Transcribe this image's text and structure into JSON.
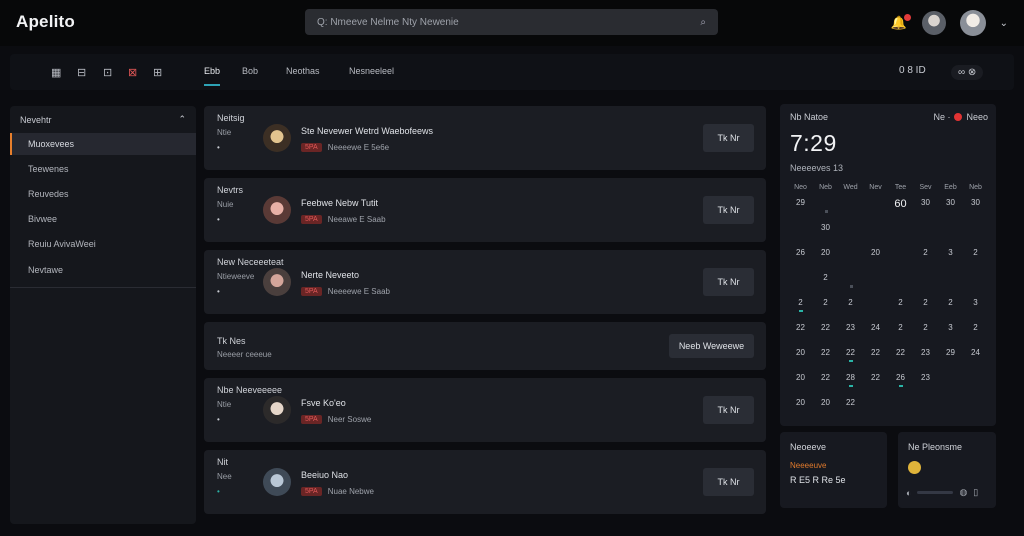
{
  "app": {
    "title": "Apelito"
  },
  "search": {
    "text": "Q: Nmeeve Nelme Nty Newenie",
    "icon": "search-icon"
  },
  "topbar": {
    "bell_icon": "bell-icon",
    "chevron": "⌄"
  },
  "subnav": {
    "icons": [
      "▦",
      "⊟",
      "⊡",
      "⊠",
      "⊞"
    ],
    "tabs": [
      "Ebb",
      "Bob",
      "Neothas",
      "Nesneeleel"
    ],
    "right_a": "0 8 ID",
    "right_b": "∞ ⊗"
  },
  "sidebar": {
    "header": "Nevehtr",
    "items": [
      "Muoxevees",
      "Teewenes",
      "Reuvedes",
      "Bivwee",
      "Reuiu AvivaWeei",
      "Nevtawe"
    ]
  },
  "cards": [
    {
      "label": "Neitsig",
      "sub": "Ntie",
      "bullet": "•",
      "name": "Ste Nevewer Wetrd Waebofeews",
      "badge": "5PA",
      "meta": "Neeeewe E 5e6e",
      "button": "Tk Nr"
    },
    {
      "label": "Nevtrs",
      "sub": "Nuie",
      "bullet": "•",
      "name": "Feebwe Nebw Tutit",
      "badge": "5PA",
      "meta": "Neeawe E Saab",
      "button": "Tk Nr"
    },
    {
      "label": "New Neceeeteat",
      "sub": "Ntieweeve",
      "bullet": "•",
      "name": "Nerte Neveeto",
      "badge": "5PA",
      "meta": "Neeeewe E Saab",
      "button": "Tk Nr"
    },
    {
      "label": "Tk Nes",
      "sub": "Neeeer ceeeue",
      "wide_button": "Neeb Weweewe"
    },
    {
      "label": "Nbe Neeveeeee",
      "sub": "Ntie",
      "bullet": "•",
      "name": "Fsve Ko'eo",
      "badge": "5PA",
      "meta": "Neer   Soswe",
      "button": "Tk Nr"
    },
    {
      "label": "Nit",
      "sub": "Nee",
      "bullet": "•",
      "name": "Beeiuo Nao",
      "badge": "5PA",
      "meta": "Nuae   Nebwe",
      "button": "Tk Nr"
    }
  ],
  "calendar": {
    "title": "Nb Natoe",
    "right_label": "Ne ·",
    "right_label2": "Neeo",
    "time": "7:29",
    "subtitle": "Neeeeves 13",
    "weekdays": [
      "Neo",
      "Neb",
      "Wed",
      "Nev",
      "Tee",
      "Sev",
      "Eeb",
      "Neb"
    ],
    "rows": [
      [
        "29",
        "",
        "",
        "",
        "60",
        "30",
        "30",
        "30"
      ],
      [
        "",
        "30",
        "",
        "",
        "",
        "",
        "",
        ""
      ],
      [
        "26",
        "20",
        "",
        "20",
        "",
        "2",
        "3",
        "2"
      ],
      [
        "",
        "2",
        "",
        "",
        "",
        "",
        "",
        ""
      ],
      [
        "2",
        "2",
        "2",
        "",
        "2",
        "2",
        "2",
        "3"
      ],
      [
        "22",
        "22",
        "23",
        "24",
        "2",
        "2",
        "3",
        "2"
      ],
      [
        "20",
        "22",
        "22",
        "22",
        "22",
        "23",
        "29",
        "24"
      ],
      [
        "20",
        "22",
        "28",
        "22",
        "26",
        "23",
        "",
        ""
      ],
      [
        "20",
        "20",
        "22",
        "",
        "",
        "",
        "",
        ""
      ]
    ]
  },
  "widgets": {
    "left": {
      "title": "Neoeeve",
      "sub": "Neeeeuve",
      "value": "R E5 R Re   5e"
    },
    "right": {
      "title": "Ne Pleonsme"
    }
  },
  "colors": {
    "accent_teal": "#2ea3b6",
    "accent_orange": "#e77f2c",
    "alert_red": "#e23b3b"
  }
}
